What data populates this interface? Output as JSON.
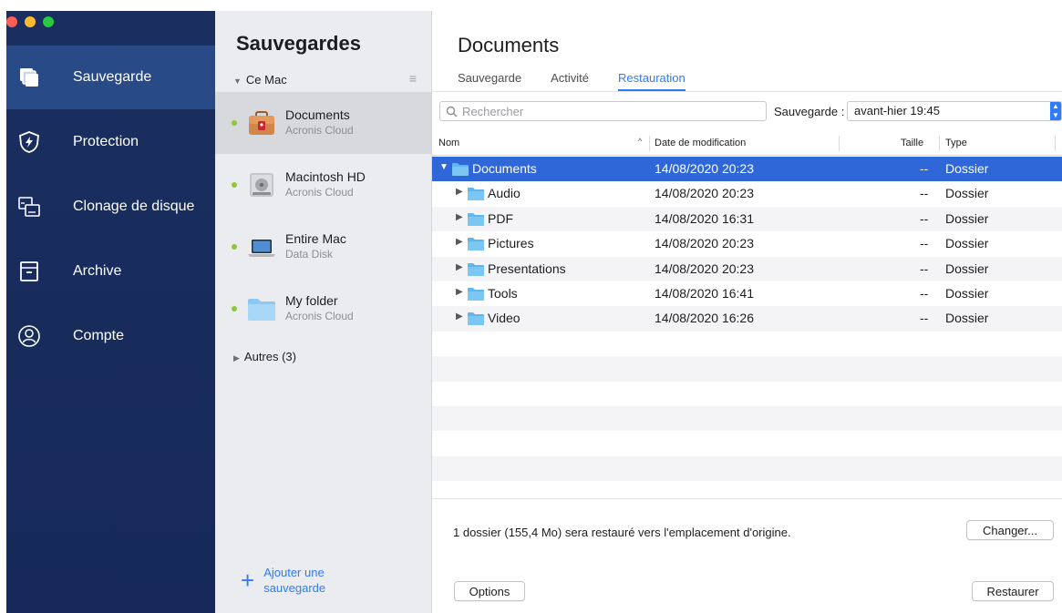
{
  "window": {
    "traffic_lights": [
      "red",
      "yellow",
      "green"
    ]
  },
  "sidebar": {
    "items": [
      {
        "label": "Sauvegarde",
        "icon": "backup-icon",
        "active": true
      },
      {
        "label": "Protection",
        "icon": "shield-icon",
        "active": false
      },
      {
        "label": "Clonage de disque",
        "icon": "disk-clone-icon",
        "active": false
      },
      {
        "label": "Archive",
        "icon": "archive-icon",
        "active": false
      },
      {
        "label": "Compte",
        "icon": "account-icon",
        "active": false
      }
    ]
  },
  "backups": {
    "title": "Sauvegardes",
    "group": "Ce Mac",
    "items": [
      {
        "name": "Documents",
        "destination": "Acronis Cloud",
        "icon": "briefcase-icon",
        "selected": true
      },
      {
        "name": "Macintosh HD",
        "destination": "Acronis Cloud",
        "icon": "hard-drive-icon",
        "selected": false
      },
      {
        "name": "Entire Mac",
        "destination": "Data Disk",
        "icon": "laptop-icon",
        "selected": false
      },
      {
        "name": "My folder",
        "destination": "Acronis Cloud",
        "icon": "folder-icon",
        "selected": false
      }
    ],
    "others": "Autres (3)",
    "add_label": "Ajouter une sauvegarde"
  },
  "content": {
    "title": "Documents",
    "tabs": [
      {
        "label": "Sauvegarde",
        "active": false
      },
      {
        "label": "Activité",
        "active": false
      },
      {
        "label": "Restauration",
        "active": true
      }
    ],
    "search_placeholder": "Rechercher",
    "backup_select_label": "Sauvegarde :",
    "backup_select_value": "avant-hier 19:45",
    "columns": {
      "name": "Nom",
      "date": "Date de modification",
      "size": "Taille",
      "type": "Type"
    },
    "rows": [
      {
        "name": "Documents",
        "date": "14/08/2020 20:23",
        "size": "--",
        "type": "Dossier",
        "level": 0,
        "expanded": true,
        "selected": true
      },
      {
        "name": "Audio",
        "date": "14/08/2020 20:23",
        "size": "--",
        "type": "Dossier",
        "level": 1,
        "expanded": false,
        "selected": false
      },
      {
        "name": "PDF",
        "date": "14/08/2020 16:31",
        "size": "--",
        "type": "Dossier",
        "level": 1,
        "expanded": false,
        "selected": false
      },
      {
        "name": "Pictures",
        "date": "14/08/2020 20:23",
        "size": "--",
        "type": "Dossier",
        "level": 1,
        "expanded": false,
        "selected": false
      },
      {
        "name": "Presentations",
        "date": "14/08/2020 20:23",
        "size": "--",
        "type": "Dossier",
        "level": 1,
        "expanded": false,
        "selected": false
      },
      {
        "name": "Tools",
        "date": "14/08/2020 16:41",
        "size": "--",
        "type": "Dossier",
        "level": 1,
        "expanded": false,
        "selected": false
      },
      {
        "name": "Video",
        "date": "14/08/2020 16:26",
        "size": "--",
        "type": "Dossier",
        "level": 1,
        "expanded": false,
        "selected": false
      }
    ],
    "restore_info": "1 dossier (155,4 Mo) sera restauré vers l'emplacement d'origine.",
    "change_button": "Changer...",
    "options_button": "Options",
    "restore_button": "Restaurer"
  },
  "colors": {
    "sidebar_bg": "#1a2f5f",
    "sidebar_active": "#284a86",
    "accent": "#2f7bf5",
    "selection": "#2f67d8",
    "status_ok": "#8dc63f"
  }
}
